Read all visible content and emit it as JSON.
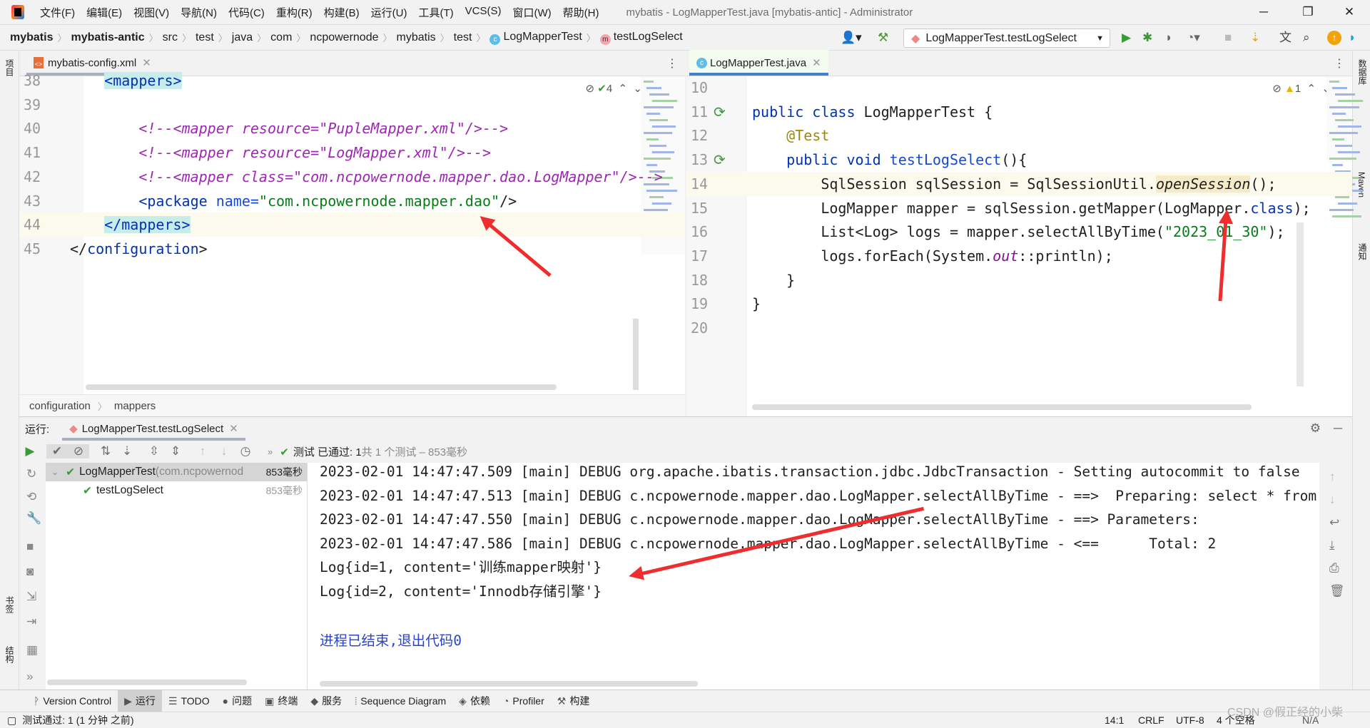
{
  "menu": [
    "文件(F)",
    "编辑(E)",
    "视图(V)",
    "导航(N)",
    "代码(C)",
    "重构(R)",
    "构建(B)",
    "运行(U)",
    "工具(T)",
    "VCS(S)",
    "窗口(W)",
    "帮助(H)"
  ],
  "window_title": "mybatis - LogMapperTest.java [mybatis-antic] - Administrator",
  "breadcrumb": [
    "mybatis",
    "mybatis-antic",
    "src",
    "test",
    "java",
    "com",
    "ncpowernode",
    "mybatis",
    "test",
    "LogMapperTest",
    "testLogSelect"
  ],
  "run_config": "LogMapperTest.testLogSelect",
  "left_strip": {
    "project": "项目",
    "bookmarks": "书签",
    "structure": "结构"
  },
  "right_strip": {
    "database": "数据库",
    "maven": "Maven",
    "notifications": "通知"
  },
  "left_editor": {
    "tab": "mybatis-config.xml",
    "inspection_count": "4",
    "lines": [
      {
        "n": "38",
        "t": [
          [
            "    ",
            ""
          ],
          [
            "<mappers>",
            "tag tagbg"
          ]
        ]
      },
      {
        "n": "39",
        "t": []
      },
      {
        "n": "40",
        "t": [
          [
            "        ",
            ""
          ],
          [
            "<!--<mapper resource=\"PupleMapper.xml\"/>-->",
            "cm"
          ]
        ]
      },
      {
        "n": "41",
        "t": [
          [
            "        ",
            ""
          ],
          [
            "<!--<mapper resource=\"LogMapper.xml\"/>-->",
            "cm"
          ]
        ]
      },
      {
        "n": "42",
        "t": [
          [
            "        ",
            ""
          ],
          [
            "<!--<mapper class=\"com.ncpowernode.mapper.dao.LogMapper\"/>-->",
            "cm"
          ]
        ]
      },
      {
        "n": "43",
        "t": [
          [
            "        ",
            ""
          ],
          [
            "<package ",
            "tag"
          ],
          [
            "name=",
            "attr"
          ],
          [
            "\"com.ncpowernode.mapper.dao\"",
            "str"
          ],
          [
            "/>",
            ""
          ]
        ]
      },
      {
        "n": "44",
        "t": [
          [
            "    ",
            ""
          ],
          [
            "</mappers>",
            "tag tagbg"
          ]
        ],
        "hl": true
      },
      {
        "n": "45",
        "t": [
          [
            "</",
            ""
          ],
          [
            "configuration",
            "tag"
          ],
          [
            ">",
            ""
          ]
        ]
      }
    ],
    "crumbs": [
      "configuration",
      "mappers"
    ]
  },
  "right_editor": {
    "tab": "LogMapperTest.java",
    "warning_count": "1",
    "lines": [
      {
        "n": "10",
        "t": []
      },
      {
        "n": "11",
        "t": [
          [
            "public class ",
            "kw"
          ],
          [
            "LogMapperTest {",
            ""
          ]
        ],
        "run": true
      },
      {
        "n": "12",
        "t": [
          [
            "    ",
            ""
          ],
          [
            "@Test",
            "an"
          ]
        ]
      },
      {
        "n": "13",
        "t": [
          [
            "    ",
            ""
          ],
          [
            "public void ",
            "kw"
          ],
          [
            "testLogSelect",
            "attr"
          ],
          [
            "(){",
            ""
          ]
        ],
        "run": true
      },
      {
        "n": "14",
        "t": [
          [
            "        SqlSession sqlSession = SqlSessionUtil.",
            ""
          ],
          [
            "openSession",
            "mhl"
          ],
          [
            "();",
            ""
          ]
        ],
        "hl": true
      },
      {
        "n": "15",
        "t": [
          [
            "        LogMapper mapper = sqlSession.getMapper(LogMapper.",
            ""
          ],
          [
            "class",
            "kw"
          ],
          [
            ");",
            ""
          ]
        ]
      },
      {
        "n": "16",
        "t": [
          [
            "        List<Log> logs = mapper.selectAllByTime(",
            ""
          ],
          [
            "\"2023_01_30\"",
            "str"
          ],
          [
            ");",
            ""
          ]
        ]
      },
      {
        "n": "17",
        "t": [
          [
            "        logs.forEach(System.",
            ""
          ],
          [
            "out",
            "st"
          ],
          [
            "::println);",
            ""
          ]
        ]
      },
      {
        "n": "18",
        "t": [
          [
            "    }",
            ""
          ]
        ]
      },
      {
        "n": "19",
        "t": [
          [
            "}",
            ""
          ]
        ]
      },
      {
        "n": "20",
        "t": []
      }
    ]
  },
  "run_panel": {
    "label": "运行:",
    "tab": "LogMapperTest.testLogSelect",
    "status_prefix": "测试 已通过: 1",
    "status_suffix": "共 1 个测试 – 853毫秒",
    "tree": [
      {
        "name": "LogMapperTest",
        "pkg": " (com.ncpowernod",
        "time": "853毫秒"
      },
      {
        "name": "testLogSelect",
        "time": "853毫秒"
      }
    ],
    "console": [
      "2023-02-01 14:47:47.509 [main] DEBUG org.apache.ibatis.transaction.jdbc.JdbcTransaction - Setting autocommit to false",
      "2023-02-01 14:47:47.513 [main] DEBUG c.ncpowernode.mapper.dao.LogMapper.selectAllByTime - ==>  Preparing: select * from",
      "2023-02-01 14:47:47.550 [main] DEBUG c.ncpowernode.mapper.dao.LogMapper.selectAllByTime - ==> Parameters: ",
      "2023-02-01 14:47:47.586 [main] DEBUG c.ncpowernode.mapper.dao.LogMapper.selectAllByTime - <==      Total: 2",
      "Log{id=1, content='训练mapper映射'}",
      "Log{id=2, content='Innodb存储引擎'}",
      "",
      "进程已结束,退出代码0"
    ]
  },
  "bottom_tabs": [
    "Version Control",
    "运行",
    "TODO",
    "问题",
    "终端",
    "服务",
    "Sequence Diagram",
    "依赖",
    "Profiler",
    "构建"
  ],
  "status_bar": {
    "message": "测试通过: 1 (1 分钟 之前)",
    "position": "14:1",
    "line_sep": "CRLF",
    "encoding": "UTF-8",
    "indent": "4 个空格",
    "extra": "N/A",
    "watermark": "CSDN @假正经的小柴"
  },
  "colors": {
    "keyword": "#0033b3",
    "string": "#067d17",
    "accent": "#4083c9",
    "annotation_arrow": "#ee2e2e"
  }
}
